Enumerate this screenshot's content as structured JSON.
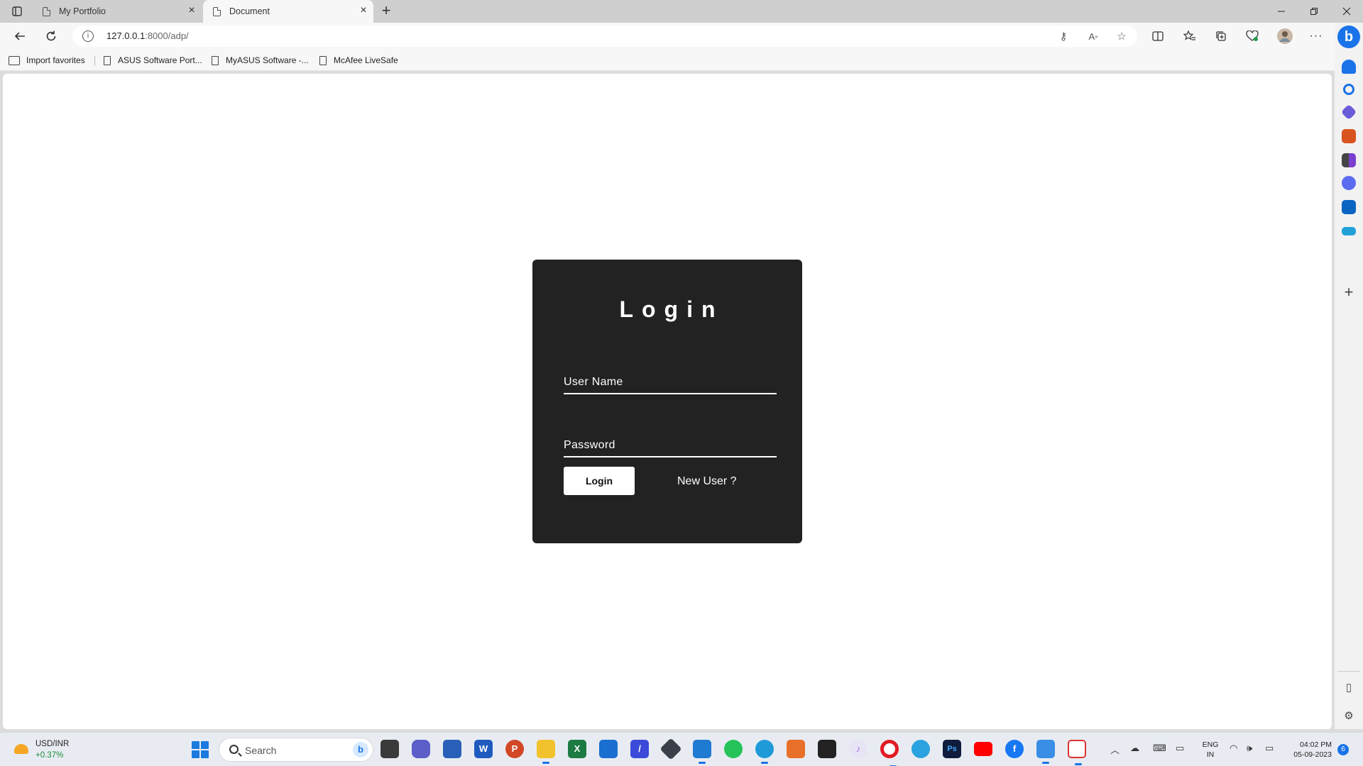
{
  "browser": {
    "tabs": [
      {
        "title": "My Portfolio",
        "active": false
      },
      {
        "title": "Document",
        "active": true
      }
    ],
    "address_host": "127.0.0.1",
    "address_path": ":8000/adp/",
    "favorites": [
      "Import favorites",
      "ASUS Software Port...",
      "MyASUS Software -...",
      "McAfee LiveSafe"
    ]
  },
  "login": {
    "title": "Login",
    "username_label": "User Name",
    "password_label": "Password",
    "login_button": "Login",
    "new_user_link": "New User ?"
  },
  "taskbar": {
    "weather_title": "USD/INR",
    "weather_change": "+0.37%",
    "search_placeholder": "Search",
    "language_line1": "ENG",
    "language_line2": "IN",
    "time": "04:02 PM",
    "date": "05-09-2023",
    "notification_count": "6"
  },
  "colors": {
    "card_background": "#222222",
    "accent": "#1a73e8"
  }
}
